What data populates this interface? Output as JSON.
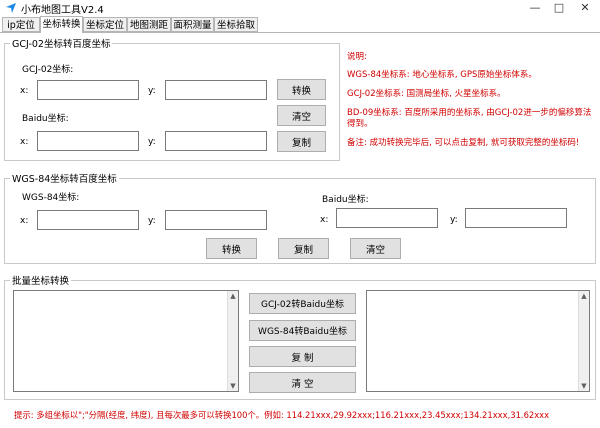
{
  "window": {
    "title": "小布地图工具V2.4",
    "minimize": "—",
    "maximize": "□",
    "close": "✕"
  },
  "tabs": [
    {
      "label": "ip定位"
    },
    {
      "label": "坐标转换"
    },
    {
      "label": "坐标定位"
    },
    {
      "label": "地图测距"
    },
    {
      "label": "面积测量"
    },
    {
      "label": "坐标拾取"
    }
  ],
  "gcj_group": {
    "legend": "GCJ-02坐标转百度坐标",
    "gcj_label": "GCJ-02坐标:",
    "baidu_label": "Baidu坐标:",
    "x_label": "x:",
    "y_label": "y:",
    "gcj_x": "",
    "gcj_y": "",
    "baidu_x": "",
    "baidu_y": "",
    "convert_btn": "转换",
    "clear_btn": "清空",
    "copy_btn": "复制"
  },
  "notes": {
    "title": "说明:",
    "line1": "WGS-84坐标系: 地心坐标系, GPS原始坐标体系。",
    "line2": "GCJ-02坐标系: 国测局坐标, 火星坐标系。",
    "line3": "BD-09坐标系: 百度所采用的坐标系, 由GCJ-02进一步的偏移算法得到。",
    "line4": "备注: 成功转换完毕后, 可以点击复制, 就可获取完整的坐标码!"
  },
  "wgs_group": {
    "legend": "WGS-84坐标转百度坐标",
    "wgs_label": "WGS-84坐标:",
    "baidu_label": "Baidu坐标:",
    "x_label": "x:",
    "y_label": "y:",
    "wgs_x": "",
    "wgs_y": "",
    "baidu_x": "",
    "baidu_y": "",
    "convert_btn": "转换",
    "copy_btn": "复制",
    "clear_btn": "清空"
  },
  "batch_group": {
    "legend": "批量坐标转换",
    "input_text": "",
    "output_text": "",
    "gcj_to_baidu_btn": "GCJ-02转Baidu坐标",
    "wgs_to_baidu_btn": "WGS-84转Baidu坐标",
    "copy_btn": "复  制",
    "clear_btn": "清  空"
  },
  "tip": "提示: 多组坐标以\";\"分隔(经度, 纬度), 且每次最多可以转换100个。例如: 114.21xxx,29.92xxx;116.21xxx,23.45xxx;134.21xxx,31.62xxx",
  "colors": {
    "note_red": "#d00000",
    "button_bg": "#e1e1e1",
    "icon_blue": "#1e88e5"
  }
}
